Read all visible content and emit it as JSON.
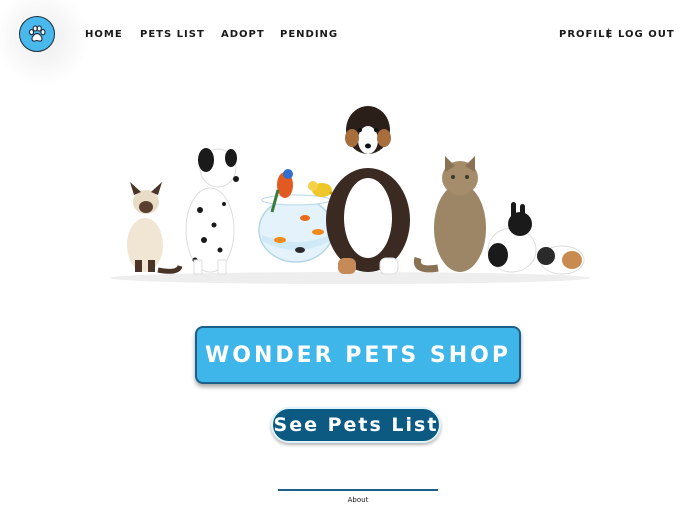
{
  "header": {
    "logo_icon": "paw-icon",
    "nav": {
      "home": "HOME",
      "pets_list": "PETS LIST",
      "adopt": "ADOPT",
      "pending": "PENDING",
      "profile": "PROFILE",
      "separator": "|",
      "logout": "LOG OUT"
    }
  },
  "hero": {
    "animals": [
      "cat",
      "dalmatian",
      "bird",
      "bird",
      "fishbowl",
      "dog",
      "cat",
      "rabbit",
      "guinea-pig"
    ]
  },
  "main": {
    "title_button": "WONDER PETS SHOP",
    "pets_button": "See Pets List"
  },
  "footer": {
    "link": "About"
  },
  "colors": {
    "accent": "#3fb6ea",
    "dark_accent": "#0c5a82",
    "border": "#1c5f88"
  }
}
